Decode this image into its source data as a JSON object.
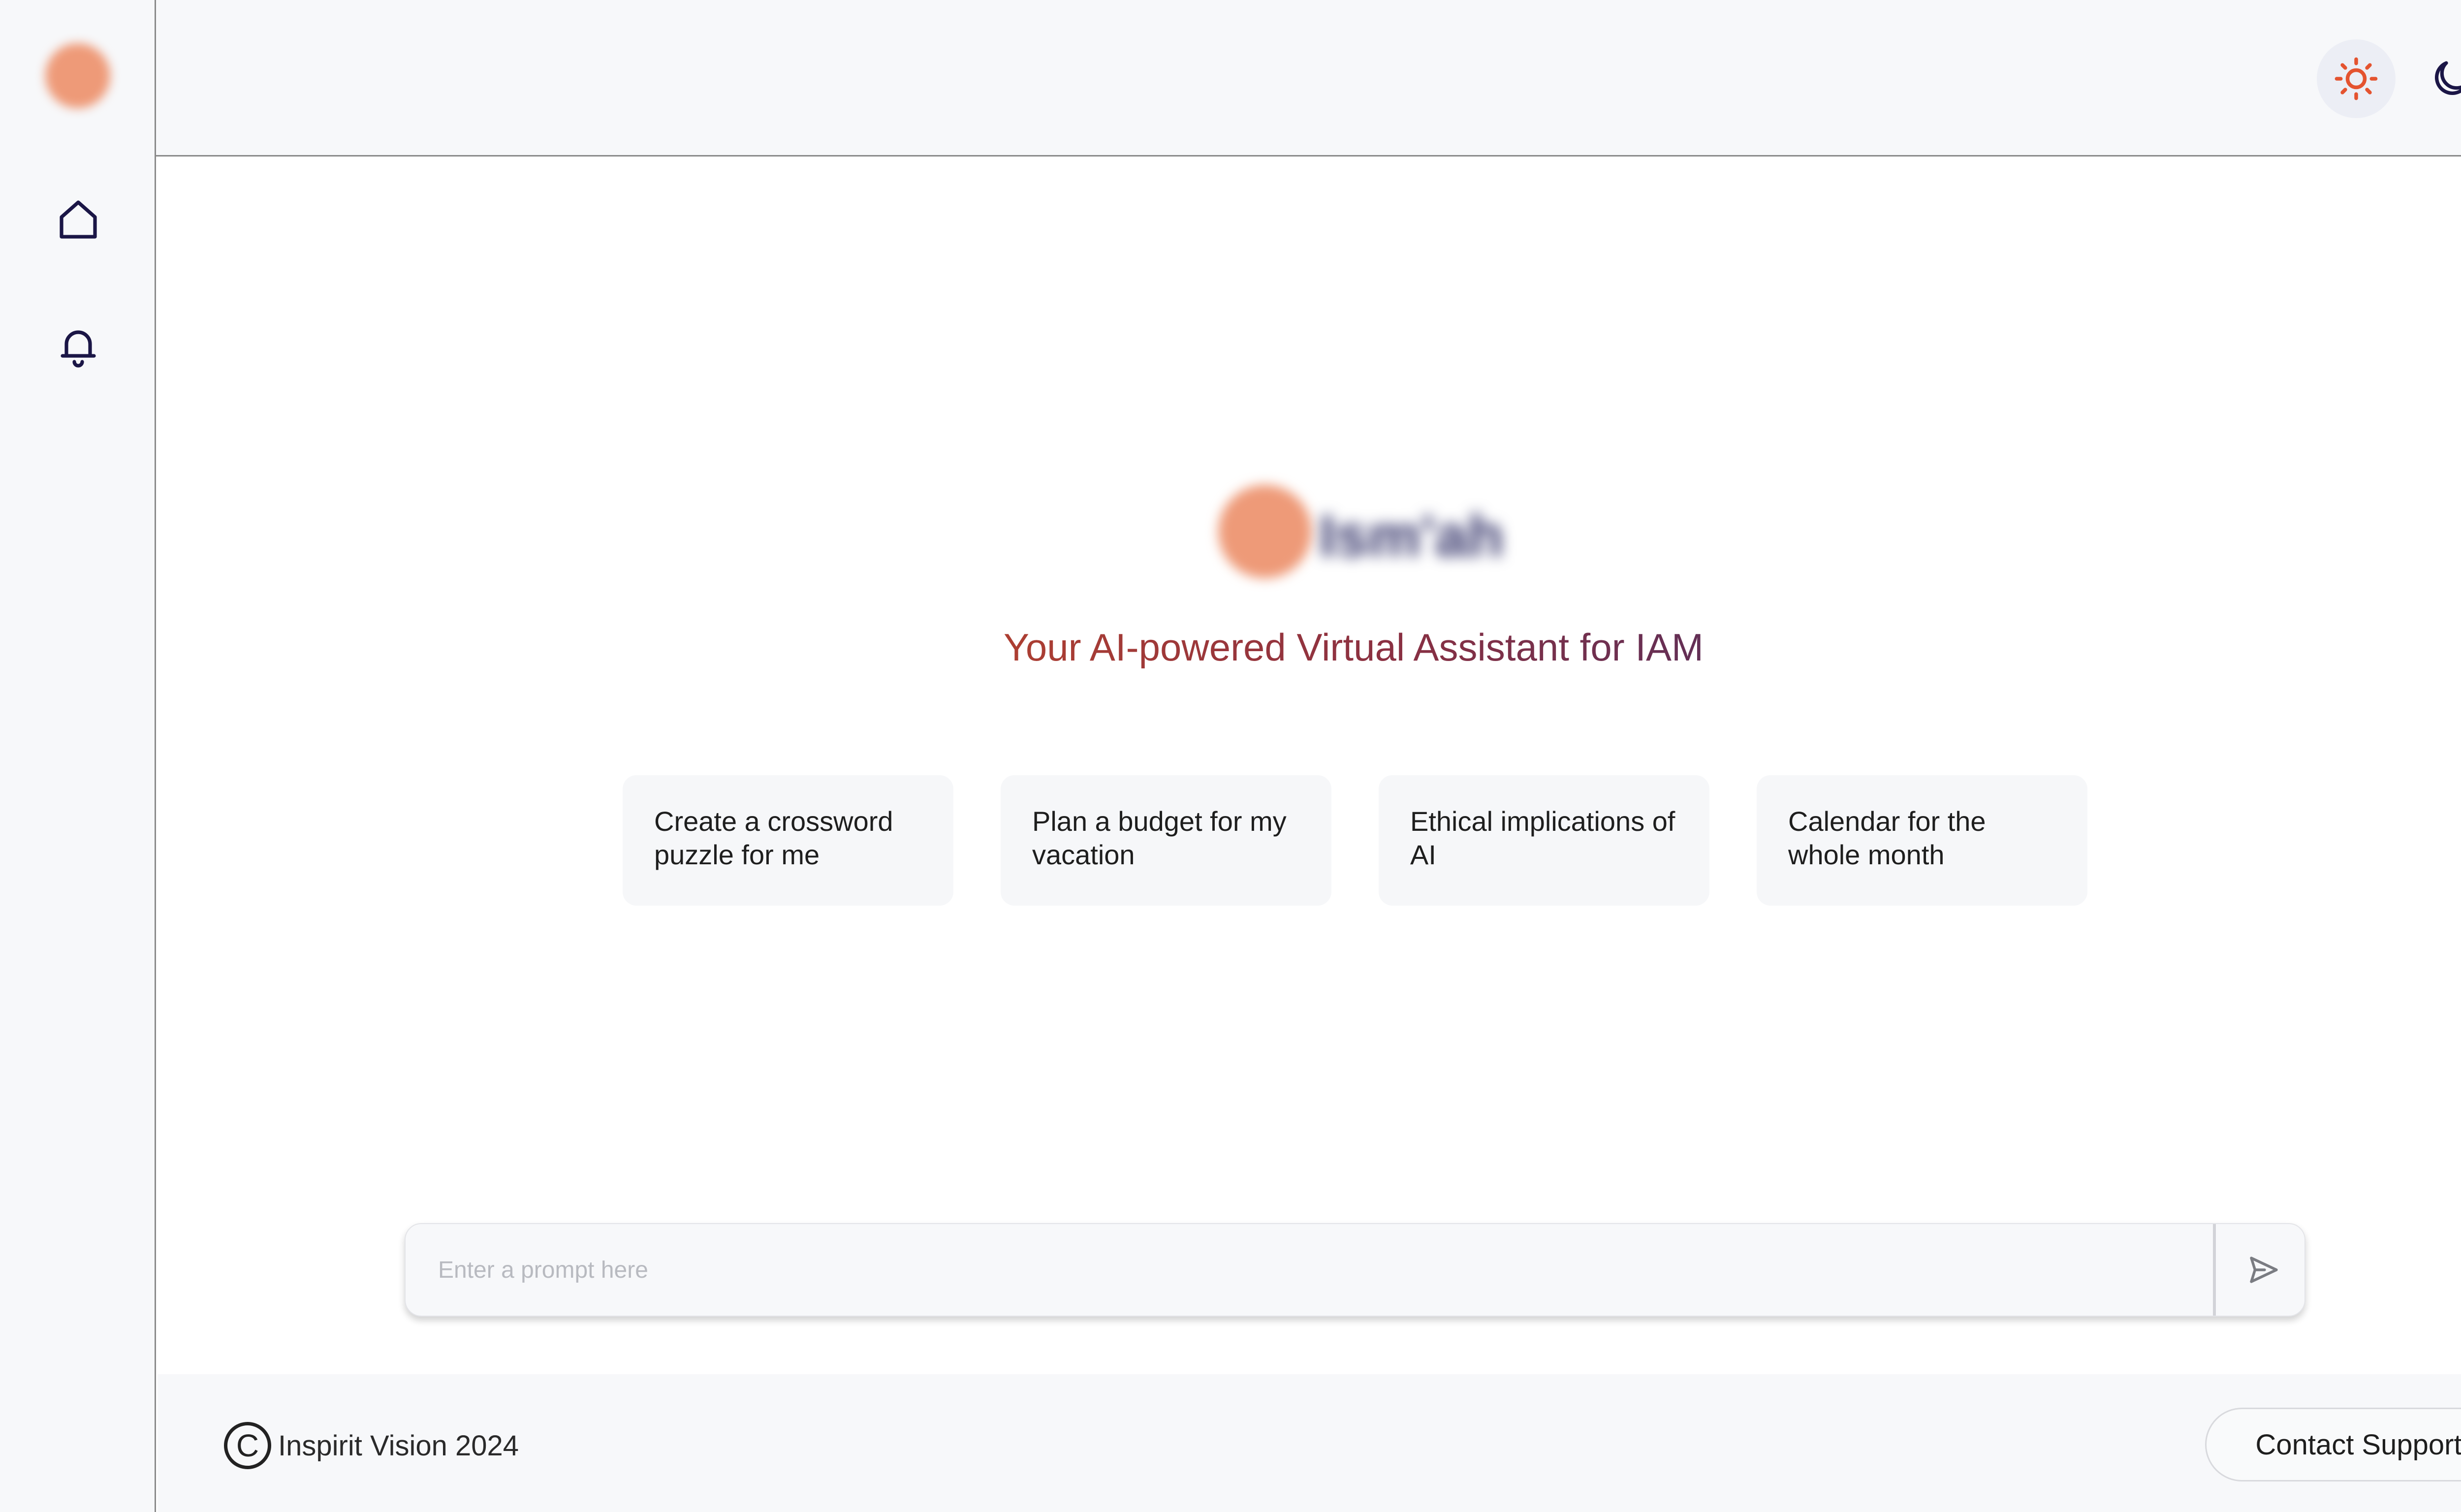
{
  "app": {
    "tagline": "Your AI-powered Virtual Assistant for IAM",
    "logo_wordmark": "Ism'ah"
  },
  "header": {
    "light_mode_icon": "sun-icon",
    "dark_mode_icon": "moon-icon"
  },
  "sidebar": {
    "items": [
      {
        "icon": "home-icon"
      },
      {
        "icon": "bell-icon"
      }
    ]
  },
  "suggestions": [
    {
      "text": "Create a crossword puzzle for me"
    },
    {
      "text": "Plan a budget for my vacation"
    },
    {
      "text": "Ethical implications of AI"
    },
    {
      "text": "Calendar for the whole month"
    }
  ],
  "prompt": {
    "placeholder": "Enter a prompt here",
    "value": "",
    "send_icon": "send-icon"
  },
  "footer": {
    "copyright_symbol": "C",
    "copyright_text": "Inspirit Vision 2024",
    "contact_label": "Contact Support"
  },
  "colors": {
    "accent_orange": "#ee9a78",
    "icon_navy": "#1b1646",
    "sun_icon": "#e4532f",
    "tagline_start": "#b3412f",
    "tagline_end": "#5a2f5a"
  }
}
